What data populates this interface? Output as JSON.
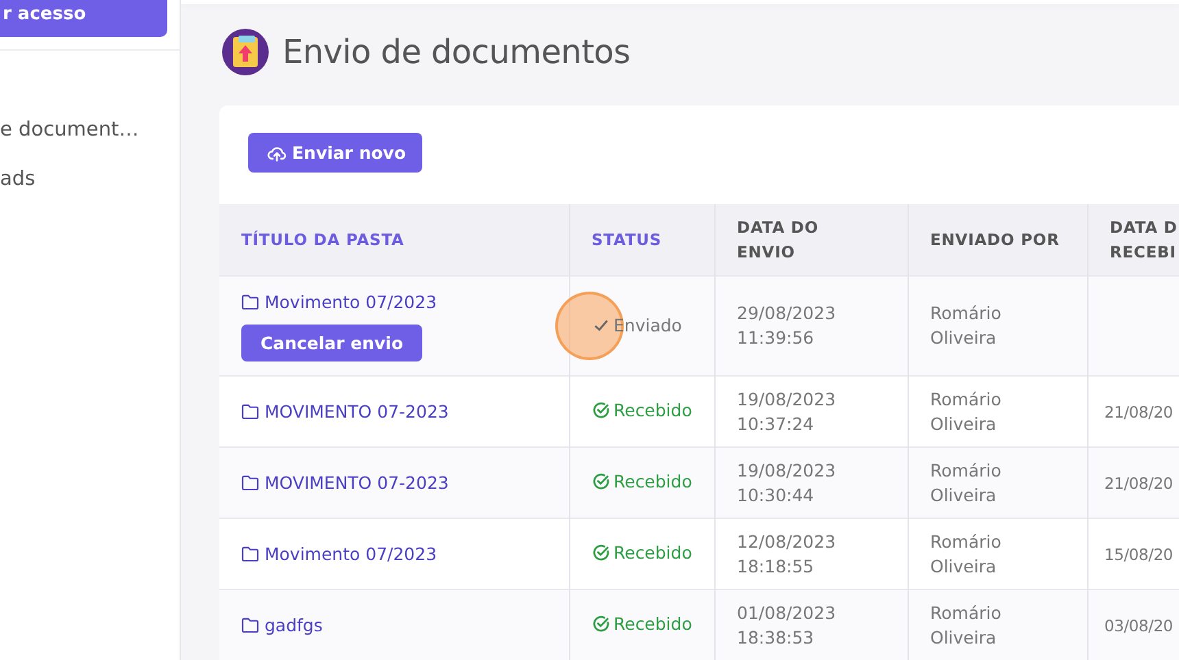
{
  "sidebar": {
    "button": "r acesso",
    "items": [
      {
        "label": "e document…"
      },
      {
        "label": "ads"
      }
    ]
  },
  "page_title": "Envio de documentos",
  "new_button": "Enviar novo",
  "table": {
    "columns": [
      {
        "label": "TÍTULO DA PASTA",
        "sortable": true
      },
      {
        "label": "STATUS",
        "sortable": true
      },
      {
        "label": "DATA DO\nENVIO",
        "sortable": false
      },
      {
        "label": "ENVIADO POR",
        "sortable": false
      },
      {
        "label": "DATA D\nRECEBI",
        "sortable": false
      }
    ],
    "rows": [
      {
        "folder": "Movimento 07/2023",
        "cancel_button": "Cancelar envio",
        "status": {
          "kind": "sent",
          "label": "Enviado"
        },
        "click_marker": true,
        "sent_date": "29/08/2023",
        "sent_time": "11:39:56",
        "sender": "Romário\nOliveira",
        "received": ""
      },
      {
        "folder": "MOVIMENTO 07-2023",
        "status": {
          "kind": "received",
          "label": "Recebido"
        },
        "click_marker": false,
        "sent_date": "19/08/2023",
        "sent_time": "10:37:24",
        "sender": "Romário\nOliveira",
        "received": "21/08/20"
      },
      {
        "folder": "MOVIMENTO 07-2023",
        "status": {
          "kind": "received",
          "label": "Recebido"
        },
        "click_marker": false,
        "sent_date": "19/08/2023",
        "sent_time": "10:30:44",
        "sender": "Romário\nOliveira",
        "received": "21/08/20"
      },
      {
        "folder": "Movimento 07/2023",
        "status": {
          "kind": "received",
          "label": "Recebido"
        },
        "click_marker": false,
        "sent_date": "12/08/2023",
        "sent_time": "18:18:55",
        "sender": "Romário\nOliveira",
        "received": "15/08/20"
      },
      {
        "folder": "gadfgs",
        "status": {
          "kind": "received",
          "label": "Recebido"
        },
        "click_marker": false,
        "sent_date": "01/08/2023",
        "sent_time": "18:38:53",
        "sender": "Romário\nOliveira",
        "received": "03/08/20"
      }
    ]
  }
}
